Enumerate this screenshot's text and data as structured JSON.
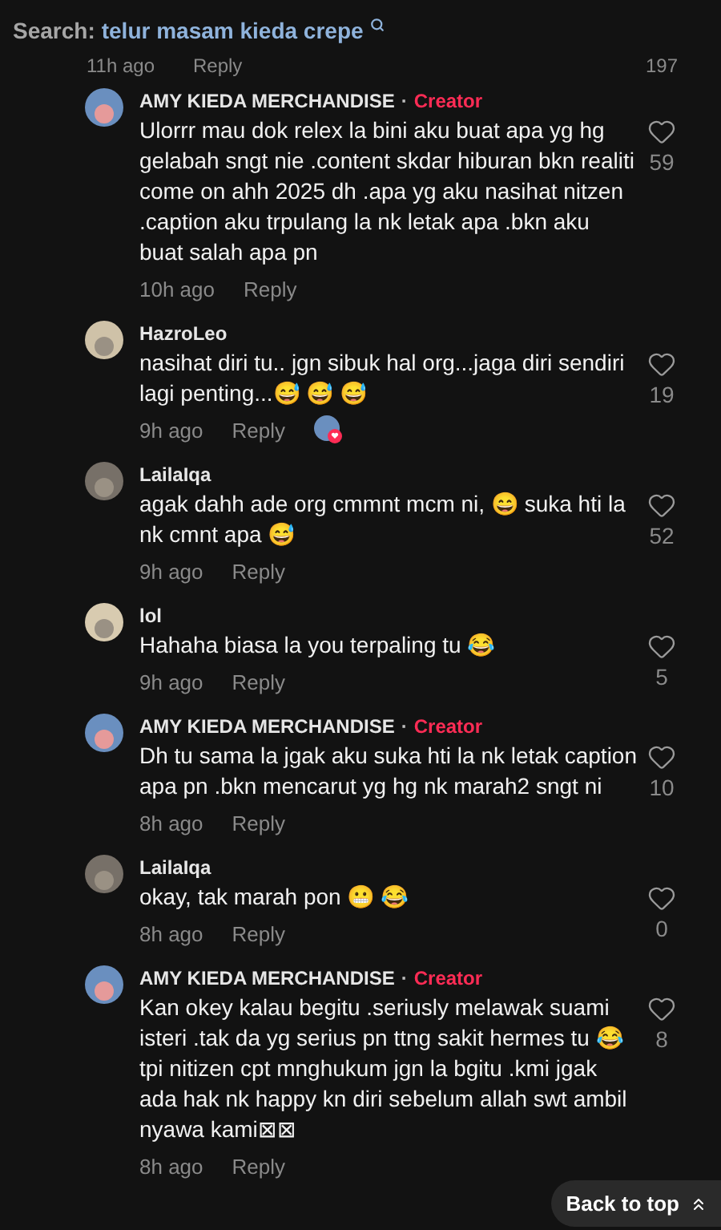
{
  "search": {
    "label": "Search:",
    "query": "telur masam kieda crepe"
  },
  "partial_row": {
    "time": "11h ago",
    "reply": "Reply",
    "likes": "197"
  },
  "comments": [
    {
      "author": "AMY KIEDA MERCHANDISE",
      "separator": "·",
      "badge": "Creator",
      "text": "Ulorrr mau dok relex la bini aku buat apa yg hg gelabah sngt nie .content skdar hiburan bkn realiti come on ahh 2025 dh .apa yg aku nasihat nitzen .caption aku trpulang la nk letak apa .bkn aku buat salah apa pn",
      "time": "10h ago",
      "reply": "Reply",
      "likes": "59",
      "creator_liked": false
    },
    {
      "author": "HazroLeo",
      "text": "nasihat diri tu.. jgn sibuk hal org...jaga diri sendiri lagi penting...😅 😅 😅",
      "time": "9h ago",
      "reply": "Reply",
      "likes": "19",
      "creator_liked": true
    },
    {
      "author": "LailaIqa",
      "text": "agak dahh ade org cmmnt mcm ni, 😄 suka hti la nk cmnt apa 😅",
      "time": "9h ago",
      "reply": "Reply",
      "likes": "52",
      "creator_liked": false
    },
    {
      "author": "lol",
      "text": "Hahaha biasa la you terpaling tu 😂",
      "time": "9h ago",
      "reply": "Reply",
      "likes": "5",
      "creator_liked": false
    },
    {
      "author": "AMY KIEDA MERCHANDISE",
      "separator": "·",
      "badge": "Creator",
      "text": "Dh tu sama la jgak aku suka hti la nk letak caption apa pn .bkn mencarut yg hg nk marah2 sngt ni",
      "time": "8h ago",
      "reply": "Reply",
      "likes": "10",
      "creator_liked": false
    },
    {
      "author": "LailaIqa",
      "text": "okay, tak marah pon 😬 😂",
      "time": "8h ago",
      "reply": "Reply",
      "likes": "0",
      "creator_liked": false
    },
    {
      "author": "AMY KIEDA MERCHANDISE",
      "separator": "·",
      "badge": "Creator",
      "text": "Kan okey kalau begitu .seriusly melawak suami isteri .tak da yg serius pn ttng sakit hermes tu 😂 tpi nitizen cpt mnghukum jgn la bgitu .kmi jgak ada hak nk happy kn diri sebelum allah swt ambil nyawa kami⊠⊠",
      "time": "8h ago",
      "reply": "Reply",
      "likes": "8",
      "creator_liked": false
    }
  ],
  "back_to_top": "Back to top"
}
